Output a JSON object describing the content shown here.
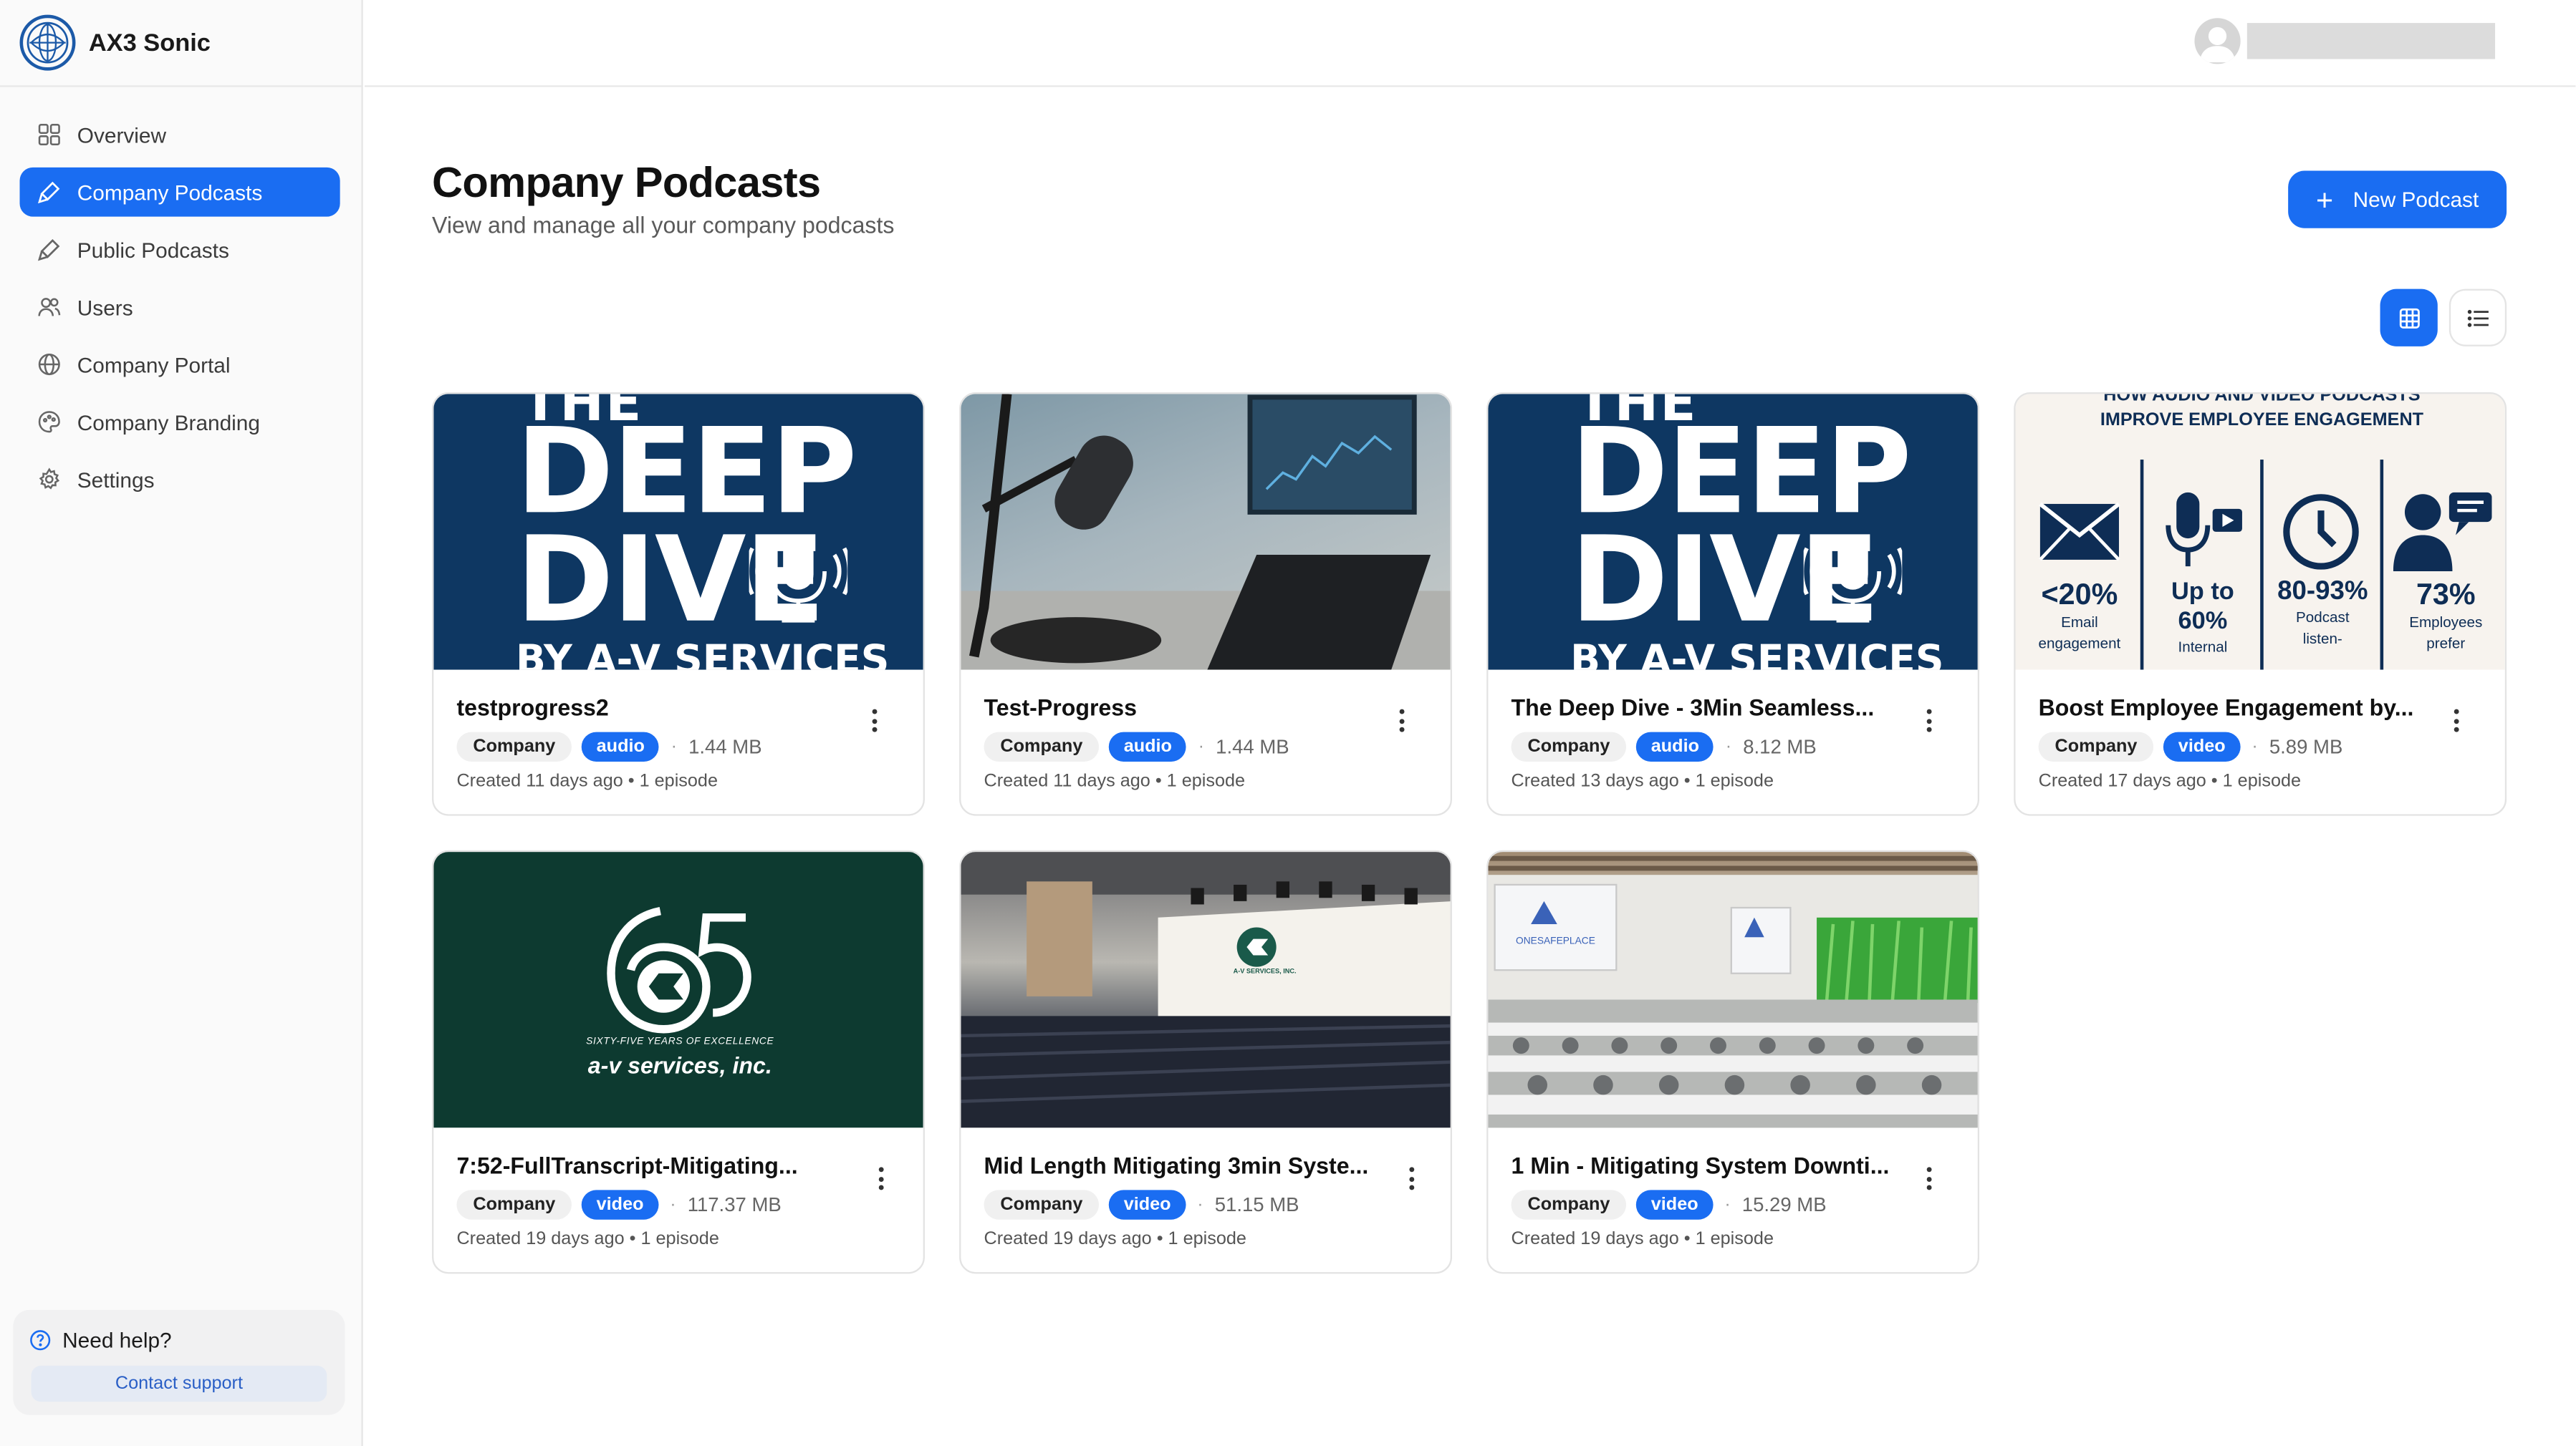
{
  "app": {
    "name": "AX3 Sonic"
  },
  "sidebar": {
    "items": [
      {
        "label": "Overview",
        "icon": "grid-icon",
        "active": false
      },
      {
        "label": "Company Podcasts",
        "icon": "mic-icon",
        "active": true
      },
      {
        "label": "Public Podcasts",
        "icon": "mic-icon",
        "active": false
      },
      {
        "label": "Users",
        "icon": "users-icon",
        "active": false
      },
      {
        "label": "Company Portal",
        "icon": "globe-icon",
        "active": false
      },
      {
        "label": "Company Branding",
        "icon": "palette-icon",
        "active": false
      },
      {
        "label": "Settings",
        "icon": "gear-icon",
        "active": false
      }
    ],
    "help": {
      "title": "Need help?",
      "button": "Contact support"
    }
  },
  "header": {
    "title": "Company Podcasts",
    "subtitle": "View and manage all your company podcasts",
    "new_button": "New Podcast"
  },
  "colors": {
    "accent": "#1a6df2"
  },
  "podcasts": [
    {
      "title": "testprogress2",
      "visibility": "Company",
      "type": "audio",
      "size": "1.44 MB",
      "meta": "Created 11 days ago • 1 episode"
    },
    {
      "title": "Test-Progress",
      "visibility": "Company",
      "type": "audio",
      "size": "1.44 MB",
      "meta": "Created 11 days ago • 1 episode"
    },
    {
      "title": "The Deep Dive - 3Min Seamless...",
      "visibility": "Company",
      "type": "audio",
      "size": "8.12 MB",
      "meta": "Created 13 days ago • 1 episode"
    },
    {
      "title": "Boost Employee Engagement by...",
      "visibility": "Company",
      "type": "video",
      "size": "5.89 MB",
      "meta": "Created 17 days ago • 1 episode"
    },
    {
      "title": "7:52-FullTranscript-Mitigating...",
      "visibility": "Company",
      "type": "video",
      "size": "117.37 MB",
      "meta": "Created 19 days ago • 1 episode"
    },
    {
      "title": "Mid Length Mitigating 3min Syste...",
      "visibility": "Company",
      "type": "video",
      "size": "51.15 MB",
      "meta": "Created 19 days ago • 1 episode"
    },
    {
      "title": "1 Min - Mitigating System Downti...",
      "visibility": "Company",
      "type": "video",
      "size": "15.29 MB",
      "meta": "Created 19 days ago • 1 episode"
    }
  ],
  "thumbnails": {
    "deepdive": {
      "line1": "THE",
      "line2": "DEEP",
      "line3": "DIVE",
      "line4": "BY A-V SERVICES"
    },
    "infographic": {
      "title1": "HOW AUDIO AND VIDEO PODCASTS",
      "title2": "IMPROVE EMPLOYEE ENGAGEMENT",
      "stats": [
        {
          "value": "<20%",
          "label1": "Email",
          "label2": "engagement"
        },
        {
          "value": "Up to 60%",
          "label1": "Internal",
          "label2": ""
        },
        {
          "value": "80-93%",
          "label1": "Podcast",
          "label2": "listen-"
        },
        {
          "value": "73%",
          "label1": "Employees",
          "label2": "prefer"
        }
      ]
    },
    "green65": {
      "tagline": "SIXTY-FIVE YEARS OF EXCELLENCE",
      "company": "a-v services, inc."
    },
    "auditorium": {
      "company": "A-V SERVICES, INC."
    },
    "conference": {
      "brand": "ONESAFEPLACE"
    }
  }
}
